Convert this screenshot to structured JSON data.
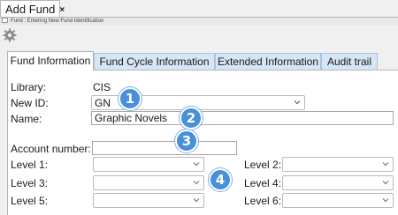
{
  "window_tab": {
    "title": "Add Fund",
    "close": "×"
  },
  "status_text": "Fund : Entering New Fund Identification",
  "tabs": [
    {
      "label": "Fund Information",
      "active": true
    },
    {
      "label": "Fund Cycle Information",
      "active": false
    },
    {
      "label": "Extended Information",
      "active": false
    },
    {
      "label": "Audit trail",
      "active": false
    }
  ],
  "form": {
    "library_label": "Library:",
    "library_value": "CIS",
    "new_id_label": "New ID:",
    "new_id_value": "GN",
    "name_label": "Name:",
    "name_value": "Graphic Novels",
    "account_label": "Account number:",
    "account_value": "",
    "levels": [
      {
        "label": "Level 1:",
        "value": ""
      },
      {
        "label": "Level 2:",
        "value": ""
      },
      {
        "label": "Level 3:",
        "value": ""
      },
      {
        "label": "Level 4:",
        "value": ""
      },
      {
        "label": "Level 5:",
        "value": ""
      },
      {
        "label": "Level 6:",
        "value": ""
      }
    ]
  },
  "markers": [
    "1",
    "2",
    "3",
    "4"
  ],
  "colors": {
    "marker": "#4a90d9",
    "tab_inactive": "#d6e6f5",
    "panel": "#ffffff"
  },
  "icons": {
    "toolbar": "gear-icon",
    "dropdown": "chevron-down-icon"
  }
}
